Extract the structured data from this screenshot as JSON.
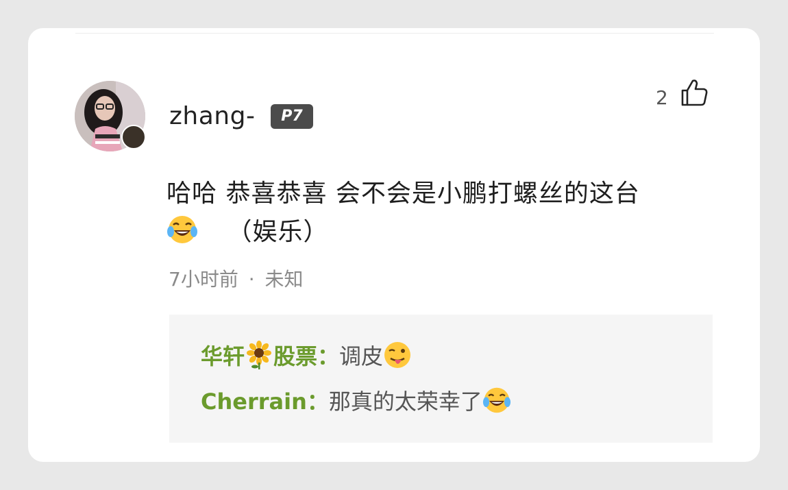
{
  "comment": {
    "username": "zhang-",
    "level_badge": "P7",
    "like_count": "2",
    "icons": {
      "avatar": "user-avatar-photo",
      "like": "thumbs-up-icon",
      "laugh_emoji": "tears-of-joy-emoji"
    },
    "text_line1": "哈哈 恭喜恭喜 会不会是小鹏打螺丝的这台",
    "text_line2": "（娱乐）",
    "time": "7小时前",
    "separator": "·",
    "location": "未知"
  },
  "replies": [
    {
      "name_part1": "华轩",
      "name_emoji": "sunflower-emoji",
      "name_part2": "股票",
      "colon": "：",
      "text": "调皮",
      "trailing_emoji": "winking-tongue-emoji"
    },
    {
      "name": "Cherrain",
      "colon": "：",
      "text": "那真的太荣幸了",
      "trailing_emoji": "tears-of-joy-emoji"
    }
  ],
  "colors": {
    "reply_name": "#6b9b2d",
    "badge_bg": "#4b4b4b",
    "reply_bg": "#f5f5f5"
  }
}
